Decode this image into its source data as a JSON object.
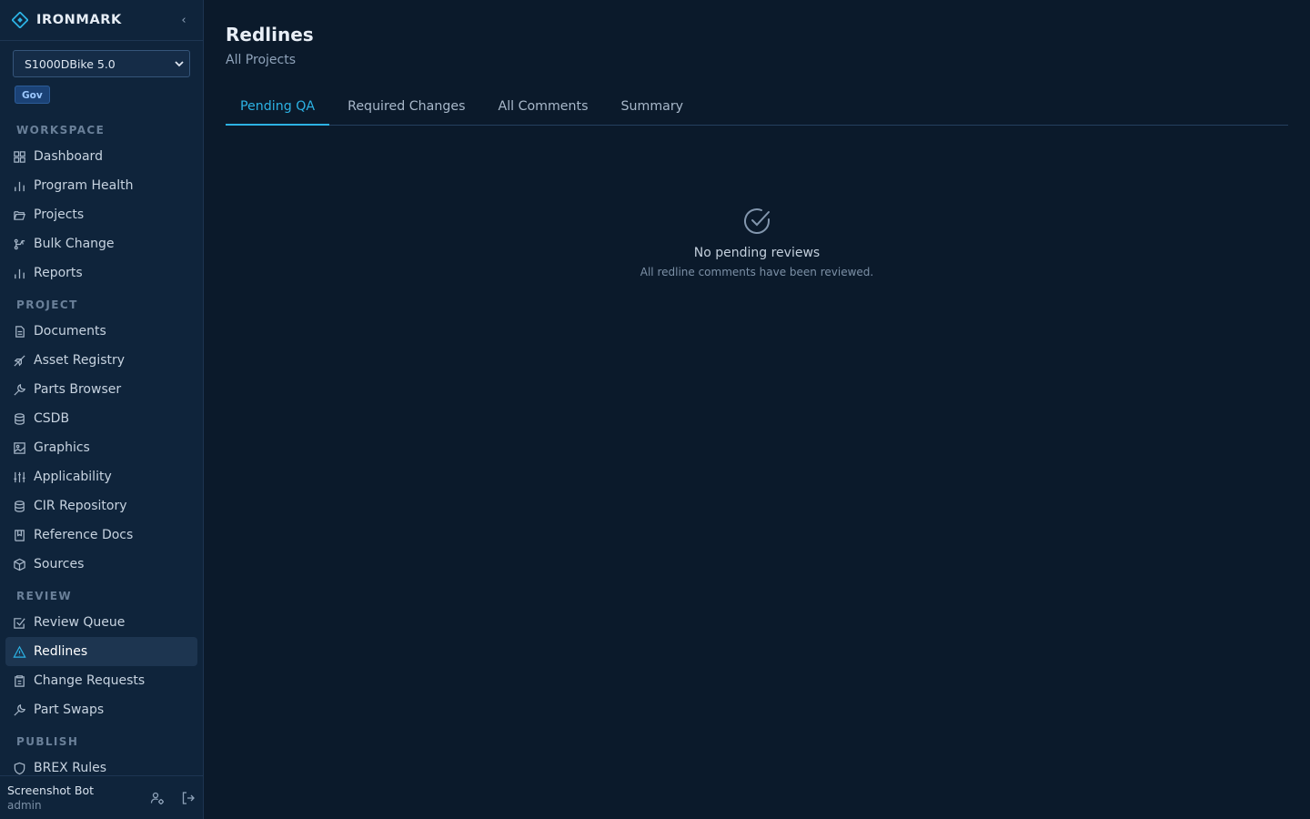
{
  "brand": {
    "name": "IRONMARK"
  },
  "project_select": {
    "value": "S1000DBike 5.0"
  },
  "badge": "Gov",
  "sections": {
    "workspace": "WORKSPACE",
    "project": "PROJECT",
    "review": "REVIEW",
    "publish": "PUBLISH"
  },
  "nav": {
    "dashboard": "Dashboard",
    "program_health": "Program Health",
    "projects": "Projects",
    "bulk_change": "Bulk Change",
    "reports": "Reports",
    "documents": "Documents",
    "asset_registry": "Asset Registry",
    "parts_browser": "Parts Browser",
    "csdb": "CSDB",
    "graphics": "Graphics",
    "applicability": "Applicability",
    "cir_repository": "CIR Repository",
    "reference_docs": "Reference Docs",
    "sources": "Sources",
    "review_queue": "Review Queue",
    "redlines": "Redlines",
    "change_requests": "Change Requests",
    "part_swaps": "Part Swaps",
    "brex_rules": "BREX Rules"
  },
  "user": {
    "name": "Screenshot Bot",
    "role": "admin"
  },
  "page": {
    "title": "Redlines",
    "subtitle": "All Projects"
  },
  "tabs": [
    "Pending QA",
    "Required Changes",
    "All Comments",
    "Summary"
  ],
  "empty": {
    "title": "No pending reviews",
    "subtitle": "All redline comments have been reviewed."
  },
  "colors": {
    "accent": "#2cb2e4",
    "background": "#0b1a2b",
    "sidebar": "#0f243b"
  }
}
